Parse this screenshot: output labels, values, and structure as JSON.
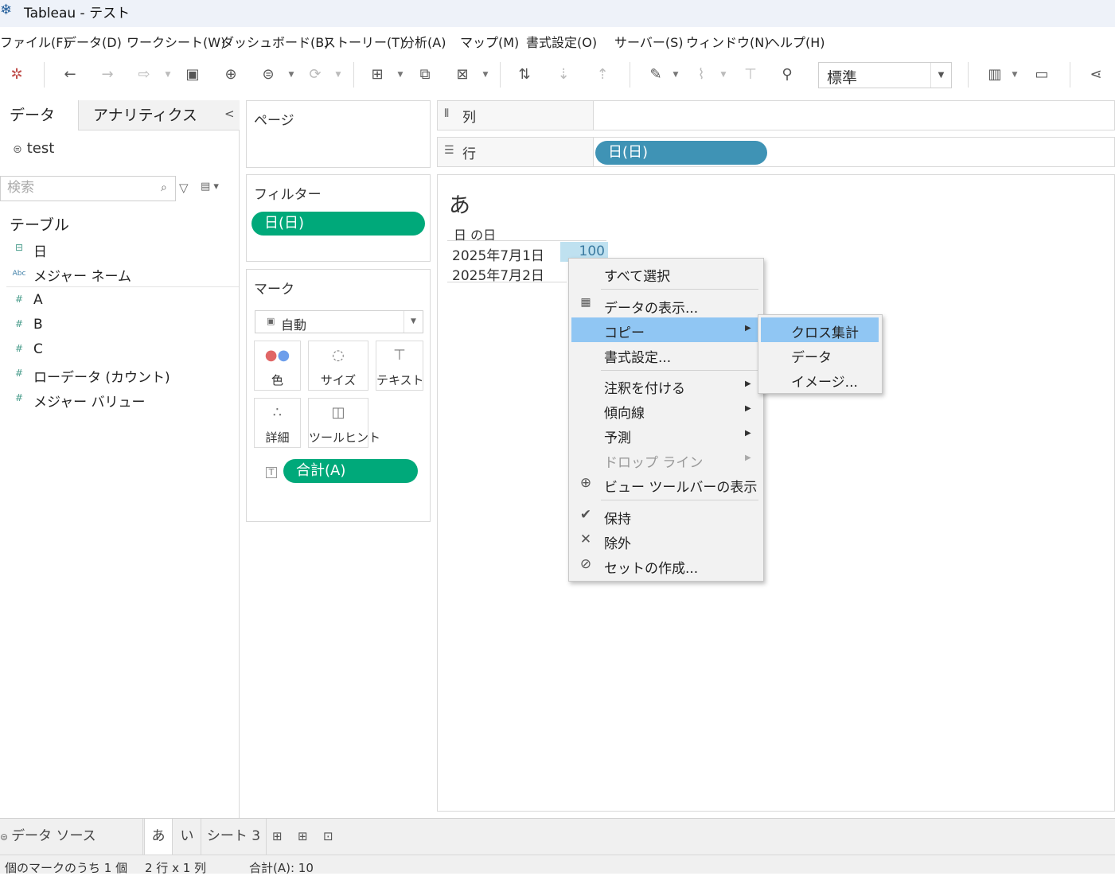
{
  "window": {
    "title": "Tableau - テスト"
  },
  "menubar": [
    "ファイル(F)",
    "データ(D)",
    "ワークシート(W)",
    "ダッシュボード(B)",
    "ストーリー(T)",
    "分析(A)",
    "マップ(M)",
    "書式設定(O)",
    "サーバー(S)",
    "ウィンドウ(N)",
    "ヘルプ(H)"
  ],
  "toolbar": {
    "view_size": "標準"
  },
  "data_pane": {
    "tabs": {
      "data": "データ",
      "analytics": "アナリティクス"
    },
    "datasource": "test",
    "search_placeholder": "検索",
    "table_heading": "テーブル",
    "fields": [
      {
        "icon": "date-icon",
        "glyph": "⊟",
        "name": "日"
      },
      {
        "icon": "abc-icon",
        "glyph": "Abc",
        "name": "メジャー ネーム"
      },
      {
        "icon": "measure-icon",
        "glyph": "#",
        "name": "A"
      },
      {
        "icon": "measure-icon",
        "glyph": "#",
        "name": "B"
      },
      {
        "icon": "measure-icon",
        "glyph": "#",
        "name": "C"
      },
      {
        "icon": "measure-icon",
        "glyph": "#",
        "name": "ローデータ (カウント)"
      },
      {
        "icon": "measure-icon",
        "glyph": "#",
        "name": "メジャー バリュー"
      }
    ]
  },
  "shelves": {
    "pages": "ページ",
    "filters": "フィルター",
    "filter_pill": "日(日)",
    "marks": "マーク",
    "mark_type": "自動",
    "mark_buttons": [
      "色",
      "サイズ",
      "テキスト",
      "詳細",
      "ツールヒント"
    ],
    "marks_pill": "合計(A)",
    "columns": "列",
    "rows": "行",
    "rows_pill": "日(日)"
  },
  "view": {
    "title": "あ",
    "column_header": "日 の日",
    "rows": [
      "2025年7月1日",
      "2025年7月2日"
    ],
    "value": "100"
  },
  "context_menu": {
    "items": [
      "すべて選択",
      "データの表示...",
      "コピー",
      "書式設定...",
      "注釈を付ける",
      "傾向線",
      "予測",
      "ドロップ ライン",
      "ビュー ツールバーの表示",
      "保持",
      "除外",
      "セットの作成..."
    ],
    "submenu": [
      "クロス集計",
      "データ",
      "イメージ..."
    ]
  },
  "sheet_tabs": [
    "データ ソース",
    "あ",
    "い",
    "シート 3"
  ],
  "status": {
    "marks": "個のマークのうち 1 個",
    "dims": "2 行 x 1 列",
    "sum": "合計(A): 10"
  },
  "colors": {
    "measure_pill": "#00a97a",
    "dimension_pill": "#3f93b5",
    "menu_highlight": "#90c6f3"
  }
}
